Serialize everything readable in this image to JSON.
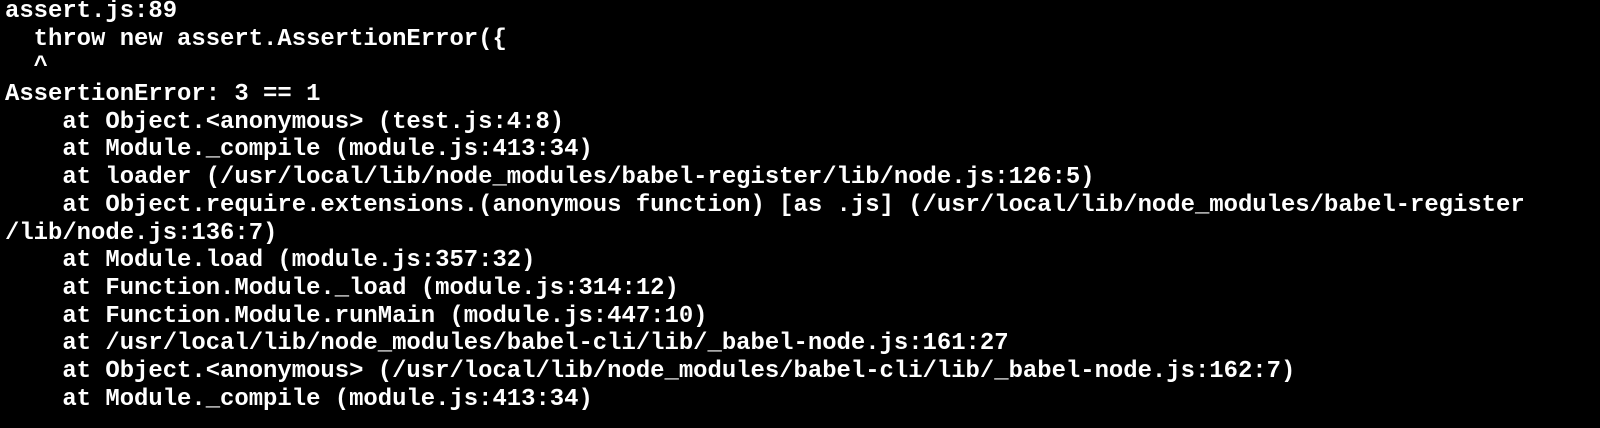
{
  "terminal": {
    "colors": {
      "background": "#000000",
      "foreground": "#ffffff"
    },
    "lines": [
      "assert.js:89",
      "  throw new assert.AssertionError({",
      "  ^",
      "AssertionError: 3 == 1",
      "    at Object.<anonymous> (test.js:4:8)",
      "    at Module._compile (module.js:413:34)",
      "    at loader (/usr/local/lib/node_modules/babel-register/lib/node.js:126:5)",
      "    at Object.require.extensions.(anonymous function) [as .js] (/usr/local/lib/node_modules/babel-register",
      "/lib/node.js:136:7)",
      "    at Module.load (module.js:357:32)",
      "    at Function.Module._load (module.js:314:12)",
      "    at Function.Module.runMain (module.js:447:10)",
      "    at /usr/local/lib/node_modules/babel-cli/lib/_babel-node.js:161:27",
      "    at Object.<anonymous> (/usr/local/lib/node_modules/babel-cli/lib/_babel-node.js:162:7)",
      "    at Module._compile (module.js:413:34)"
    ]
  }
}
